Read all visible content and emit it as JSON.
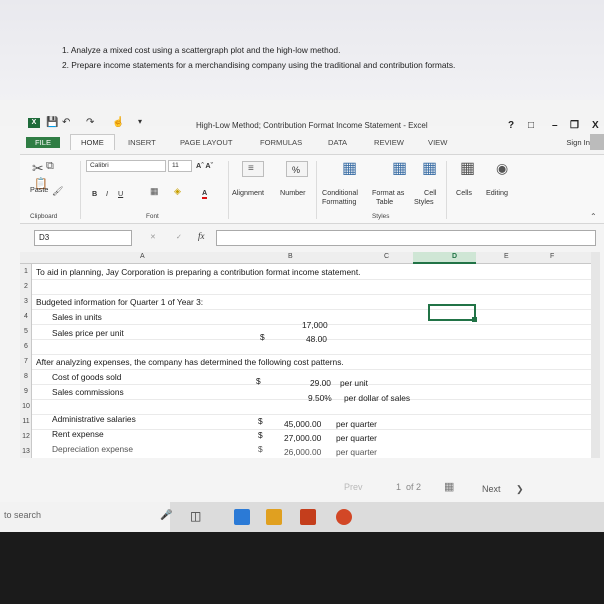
{
  "instructions": [
    "1. Analyze a mixed cost using a scattergraph plot and the high-low method.",
    "2. Prepare income statements for a merchandising company using the traditional and contribution formats."
  ],
  "window": {
    "title": "High-Low Method; Contribution Format Income Statement - Excel",
    "help": "?",
    "controls": [
      "–",
      "□",
      "X"
    ]
  },
  "tabs": [
    "FILE",
    "HOME",
    "INSERT",
    "PAGE LAYOUT",
    "FORMULAS",
    "DATA",
    "REVIEW",
    "VIEW"
  ],
  "sign_in": "Sign In",
  "ribbon": {
    "paste": "Paste",
    "clipboard": "Clipboard",
    "font_name": "Calibri",
    "font_size": "11",
    "grow_shrink": "Aˆ Aˇ",
    "bold": "B",
    "italic": "I",
    "underline": "U",
    "font_color": "A",
    "font_group": "Font",
    "alignment": "Alignment",
    "number": "Number",
    "percent": "%",
    "conditional_formatting": [
      "Conditional",
      "Formatting"
    ],
    "format_as_table": [
      "Format as",
      "Table"
    ],
    "cell_styles": [
      "Cell",
      "Styles"
    ],
    "styles_group": "Styles",
    "cells": "Cells",
    "editing": "Editing"
  },
  "formula_bar": {
    "name_box": "D3",
    "fx": "fx",
    "cancel": "✕",
    "enter": "✓"
  },
  "columns": [
    "A",
    "B",
    "C",
    "D",
    "E",
    "F"
  ],
  "rows": [
    "1",
    "2",
    "3",
    "4",
    "5",
    "6",
    "7",
    "8",
    "9",
    "10",
    "11",
    "12",
    "13"
  ],
  "cells": {
    "r1": "To aid in planning, Jay Corporation is preparing a contribution format income statement.",
    "r3": "Budgeted information for Quarter 1 of Year 3:",
    "r4": "Sales in units",
    "r4_b": "17,000",
    "r5": "Sales price per unit",
    "r5_dollar": "$",
    "r5_b": "48.00",
    "r7": "After analyzing expenses, the company has determined the following cost patterns.",
    "r8": "Cost of goods sold",
    "r8_dollar": "$",
    "r8_b": "29.00",
    "r8_c": "per unit",
    "r9": "Sales commissions",
    "r9_b": "9.50%",
    "r9_c": "per dollar of sales",
    "r11": "Administrative salaries",
    "r11_dollar": "$",
    "r11_b": "45,000.00",
    "r11_c": "per quarter",
    "r12": "Rent expense",
    "r12_dollar": "$",
    "r12_b": "27,000.00",
    "r12_c": "per quarter",
    "r13": "Depreciation expense",
    "r13_dollar": "$",
    "r13_b": "26,000.00",
    "r13_c": "per quarter"
  },
  "viewer": {
    "prev": "Prev",
    "page": "1",
    "of": "of 2",
    "next": "Next",
    "next_arrow": "❯"
  },
  "taskbar": {
    "search": "to search"
  }
}
